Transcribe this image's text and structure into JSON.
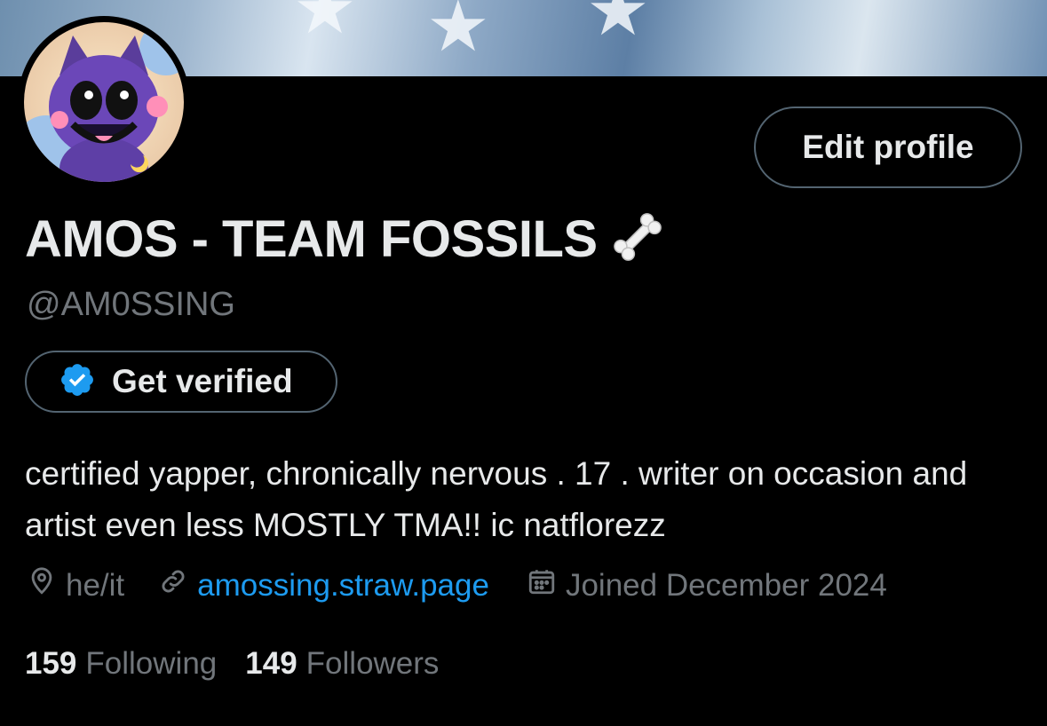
{
  "profile": {
    "display_name": "AMOS - TEAM FOSSILS",
    "name_emoji": "bone-emoji",
    "handle": "@AM0SSING",
    "bio": "certified yapper, chronically nervous . 17 . writer on occasion and artist even less MOSTLY TMA!! ic natflorezz",
    "location": "he/it",
    "website": "amossing.straw.page",
    "joined": "Joined December 2024"
  },
  "buttons": {
    "edit_profile": "Edit profile",
    "get_verified": "Get verified"
  },
  "stats": {
    "following_count": "159",
    "following_label": "Following",
    "followers_count": "149",
    "followers_label": "Followers"
  },
  "icons": {
    "location": "location-pin-icon",
    "website": "link-icon",
    "joined": "calendar-icon",
    "verified": "verified-badge-icon"
  },
  "colors": {
    "background": "#000000",
    "text_primary": "#e7e9ea",
    "text_secondary": "#71767b",
    "accent": "#1d9bf0",
    "border": "#536471"
  }
}
